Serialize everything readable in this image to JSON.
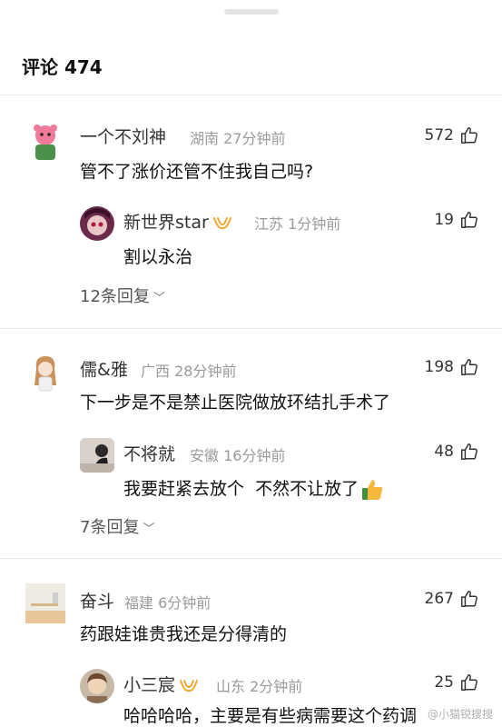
{
  "header": {
    "title": "评论 474"
  },
  "comments": [
    {
      "user": "一个不刘神",
      "location": "湖南",
      "time": "27分钟前",
      "likes": "572",
      "text": "管不了涨价还管不住我自己吗?",
      "reply": {
        "user": "新世界star",
        "location": "江苏",
        "time": "1分钟前",
        "likes": "19",
        "text": "割以永治"
      },
      "more_replies": "12条回复"
    },
    {
      "user": "儒&雅",
      "location": "广西",
      "time": "28分钟前",
      "likes": "198",
      "text": "下一步是不是禁止医院做放环结扎手术了",
      "reply": {
        "user": "不将就",
        "location": "安徽",
        "time": "16分钟前",
        "likes": "48",
        "text": "我要赶紧去放个  不然不让放了"
      },
      "more_replies": "7条回复"
    },
    {
      "user": "奋斗",
      "location": "福建",
      "time": "6分钟前",
      "likes": "267",
      "text": "药跟娃谁贵我还是分得清的",
      "reply": {
        "user": "小三宸",
        "location": "山东",
        "time": "2分钟前",
        "likes": "25",
        "text": "哈哈哈哈，主要是有些病需要这个药调"
      }
    }
  ],
  "watermark": "@小猫锐搜搜",
  "icons": {
    "like": "thumb-up-icon",
    "badge": "vip-badge-icon",
    "emoji": "thumbs-up-emoji",
    "chevron": "chevron-down-icon"
  },
  "colors": {
    "badge": "#f0a93a",
    "emoji": "#f6b83c",
    "meta": "#9a9a9a"
  }
}
